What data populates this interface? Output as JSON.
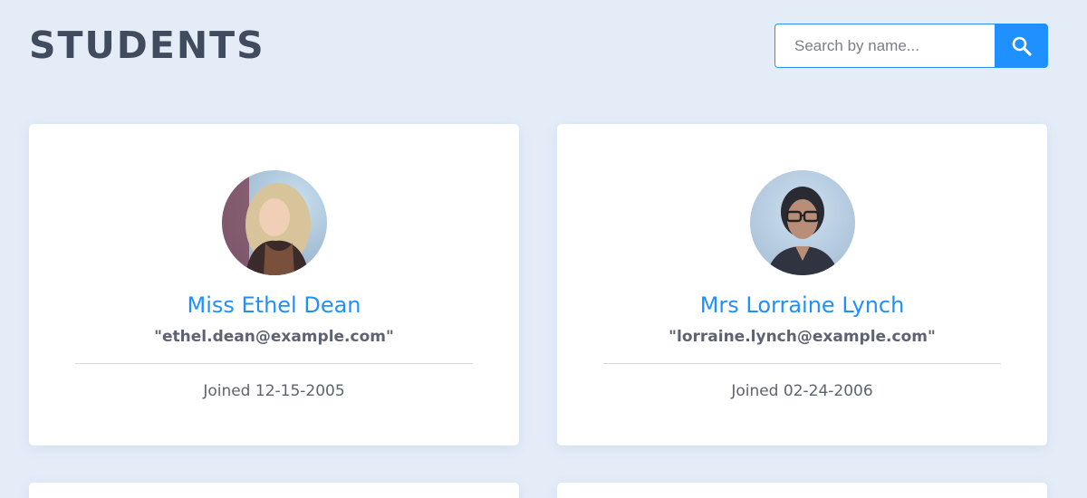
{
  "header": {
    "title": "STUDENTS"
  },
  "search": {
    "placeholder": "Search by name...",
    "button_icon": "search-icon"
  },
  "colors": {
    "background": "#e4ecf8",
    "accent": "#1e90ff",
    "title": "#414b5e",
    "text": "#5d6370"
  },
  "students": [
    {
      "name": "Miss Ethel Dean",
      "email": "\"ethel.dean@example.com\"",
      "joined": "Joined 12-15-2005"
    },
    {
      "name": "Mrs Lorraine Lynch",
      "email": "\"lorraine.lynch@example.com\"",
      "joined": "Joined 02-24-2006"
    }
  ]
}
